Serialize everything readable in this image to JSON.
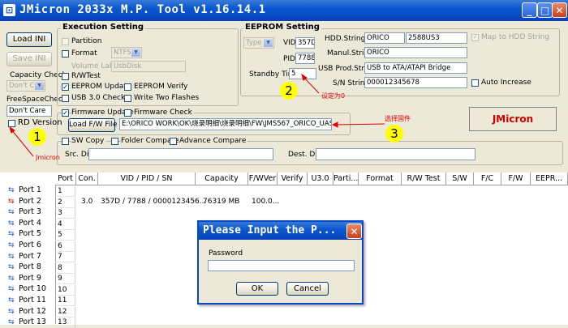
{
  "window": {
    "title": "JMicron 2033x M.P. Tool v1.16.14.1"
  },
  "left_panel": {
    "load_ini": "Load INI",
    "save_ini": "Save INI",
    "capacity_check": "Capacity Check",
    "capacity_value": "Don't Care",
    "free_space_check": "FreeSpaceCheck",
    "free_space_value": "Don't Care",
    "rd_version": "RD Version"
  },
  "execution": {
    "title": "Execution Setting",
    "partition": "Partition",
    "format": "Format",
    "format_value": "NTFS",
    "volume_label": "Volume Label",
    "volume_value": "UsbDisk",
    "rw_test": "R/WTest",
    "eeprom_update": "EEPROM Update",
    "eeprom_verify": "EEPROM Verify",
    "usb3_check": "USB 3.0 Check",
    "write_two_flashes": "Write Two Flashes",
    "firmware_update": "Firmware Update",
    "firmware_check": "Firmware Check",
    "load_fw_file": "Load F/W File",
    "fw_path": "E:\\ORICO WORK\\OK\\烧录明细\\烧录明细\\FW\\JMS567_ORICO_UASP_v10",
    "sw_copy": "SW Copy",
    "folder_compare": "Folder Compare",
    "advance_compare": "Advance Compare",
    "src_dir": "Src. Dir.",
    "dest_dir": "Dest. Dir."
  },
  "eeprom": {
    "title": "EEPROM Setting",
    "type_value": "Type 3",
    "vid_label": "VID",
    "vid_value": "357D",
    "pid_label": "PID",
    "pid_value": "7788",
    "standby_label": "Standby Timer",
    "standby_value": "5",
    "hdd_string_label": "HDD.String",
    "hdd_string_value": "ORICO",
    "hdd_string_value2": "2588US3",
    "map_to_hdd": "Map to HDD String",
    "manul_string_label": "Manul.String",
    "manul_string_value": "ORICO",
    "usb_prod_label": "USB Prod.String",
    "usb_prod_value": "USB to ATA/ATAPI Bridge",
    "sn_label": "S/N String",
    "sn_value": "000012345678",
    "auto_increase": "Auto Increase"
  },
  "brand_button": "JMicron",
  "annotations": {
    "a1": "1",
    "a1_text": "Jmicron",
    "a2": "2",
    "a2_text": "设定为0",
    "a3": "3",
    "a3_text": "选择固件"
  },
  "table": {
    "headers": [
      "Port",
      "Con.",
      "VID / PID / SN",
      "Capacity",
      "F/WVer",
      "Verify",
      "U3.0",
      "Parti...",
      "Format",
      "R/W Test",
      "S/W",
      "F/C",
      "F/W",
      "EEPR..."
    ],
    "rows": [
      "1",
      "2",
      "3",
      "4",
      "5",
      "6",
      "7",
      "8",
      "9",
      "10",
      "11",
      "12",
      "13"
    ],
    "row2": {
      "con": "3.0",
      "vid_pid_sn": "357D / 7788 / 0000123456...",
      "capacity": "76319 MB",
      "fwver": "100.0..."
    }
  },
  "ports": [
    "Port  1",
    "Port  2",
    "Port  3",
    "Port  4",
    "Port  5",
    "Port  6",
    "Port  7",
    "Port  8",
    "Port  9",
    "Port 10",
    "Port 11",
    "Port 12",
    "Port 13"
  ],
  "dialog": {
    "title": "Please Input the P...",
    "password_label": "Password",
    "ok": "OK",
    "cancel": "Cancel"
  }
}
